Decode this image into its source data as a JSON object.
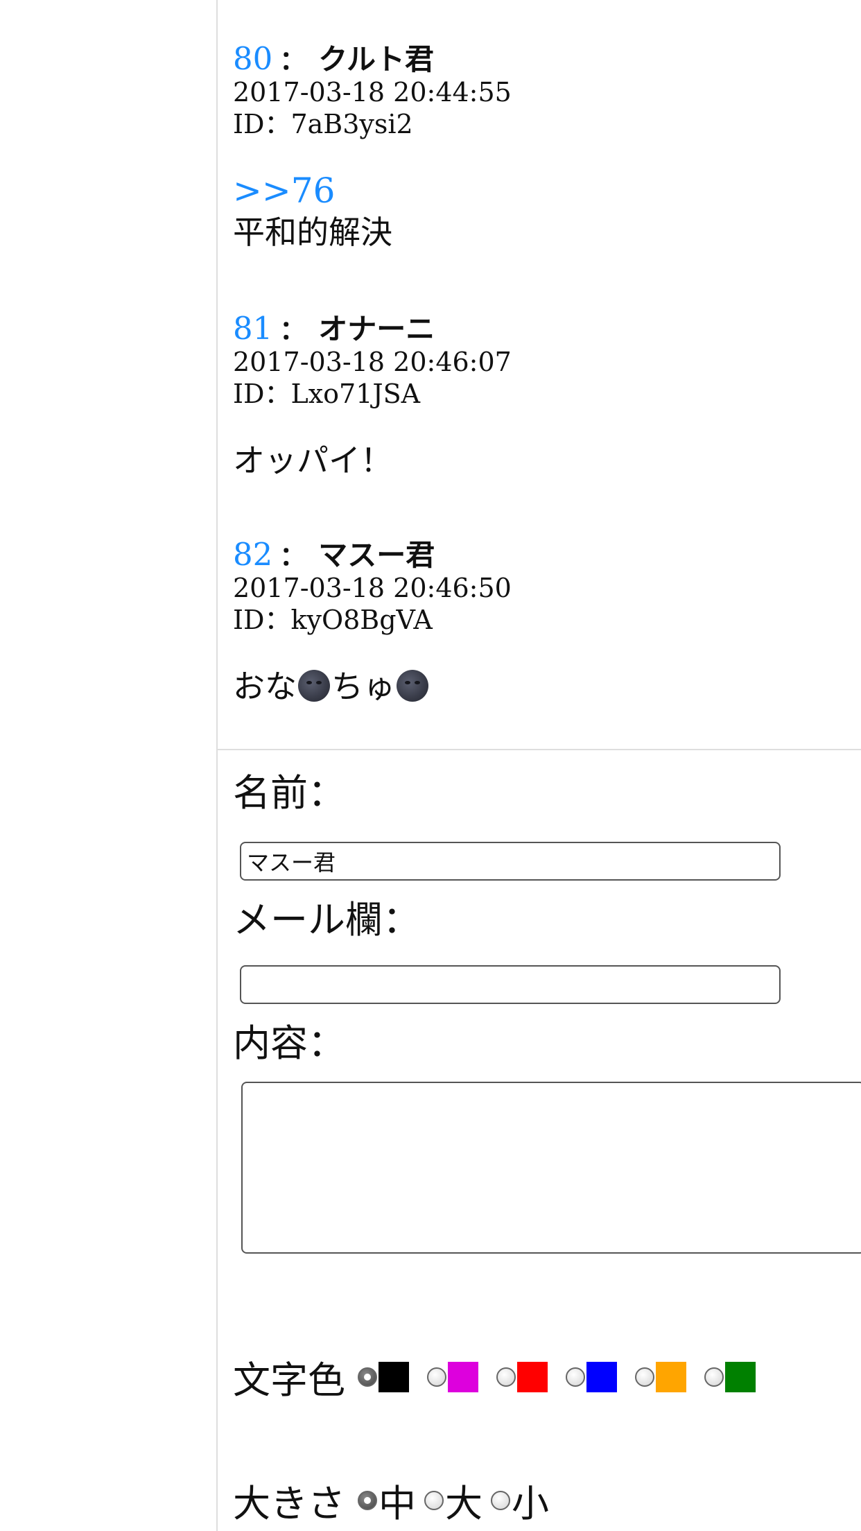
{
  "posts": [
    {
      "no": "80",
      "sep": "：",
      "name": "クルト君",
      "date": "2017-03-18 20:44:55",
      "id": "ID：7aB3ysi2",
      "anchor": ">>76",
      "text": "平和的解決"
    },
    {
      "no": "81",
      "sep": "：",
      "name": "オナーニ",
      "date": "2017-03-18 20:46:07",
      "id": "ID：Lxo71JSA",
      "text": "オッパイ！"
    },
    {
      "no": "82",
      "sep": "：",
      "name": "マスー君",
      "date": "2017-03-18 20:46:50",
      "id": "ID：kyO8BgVA",
      "text_parts": [
        "おな",
        "ちゅ"
      ],
      "emoji": "new-moon-face-icon"
    }
  ],
  "form": {
    "name_label": "名前：",
    "name_value": "マスー君",
    "mail_label": "メール欄：",
    "mail_value": "",
    "content_label": "内容：",
    "content_value": "",
    "color_label": "文字色",
    "colors": [
      "#000000",
      "#dd00dd",
      "#ff0000",
      "#0000ff",
      "#ffa500",
      "#008000"
    ],
    "color_selected_index": 0,
    "size_label": "大きさ",
    "sizes": [
      "中",
      "大",
      "小"
    ],
    "size_selected_index": 0
  },
  "colors": {
    "link": "#1a8cff",
    "divider": "#dedede"
  }
}
